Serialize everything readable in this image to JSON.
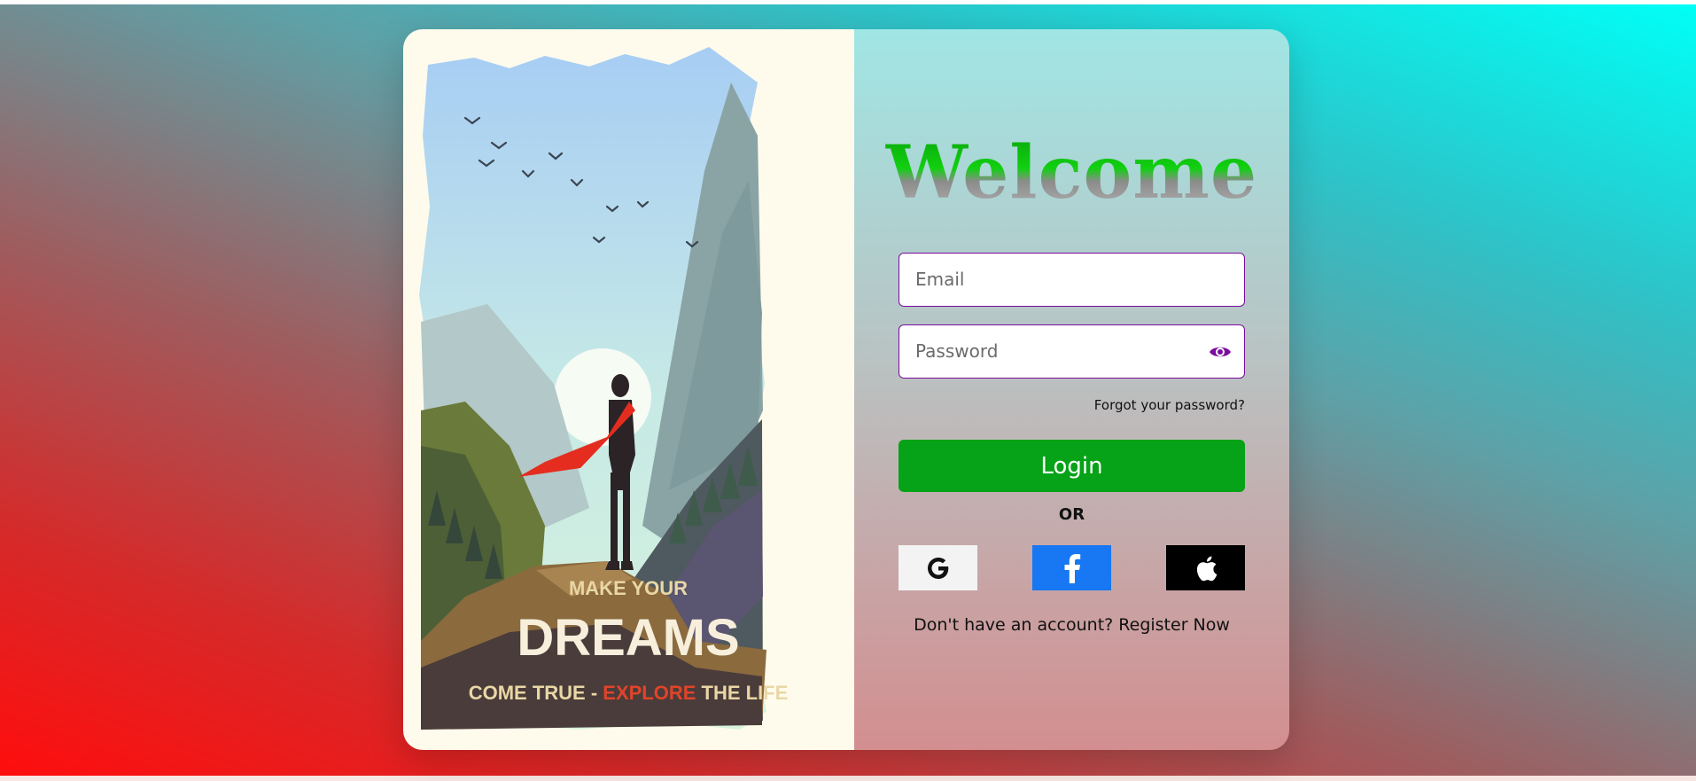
{
  "form": {
    "title": "Welcome",
    "email_placeholder": "Email",
    "password_placeholder": "Password",
    "forgot_label": "Forgot your password?",
    "login_label": "Login",
    "or_label": "OR",
    "register_prompt": "Don't have an account?",
    "register_link": "Register Now"
  },
  "poster": {
    "line1": "MAKE YOUR",
    "line2": "DREAMS",
    "line3_a": "COME TRUE - ",
    "line3_b": "EXPLORE",
    "line3_c": " THE LIFE"
  },
  "social": {
    "google_icon": "google-icon",
    "facebook_icon": "facebook-icon",
    "apple_icon": "apple-icon"
  },
  "colors": {
    "login_green": "#06a217",
    "input_border": "#7a0c9e",
    "facebook_blue": "#1877f2",
    "apple_black": "#000000"
  }
}
